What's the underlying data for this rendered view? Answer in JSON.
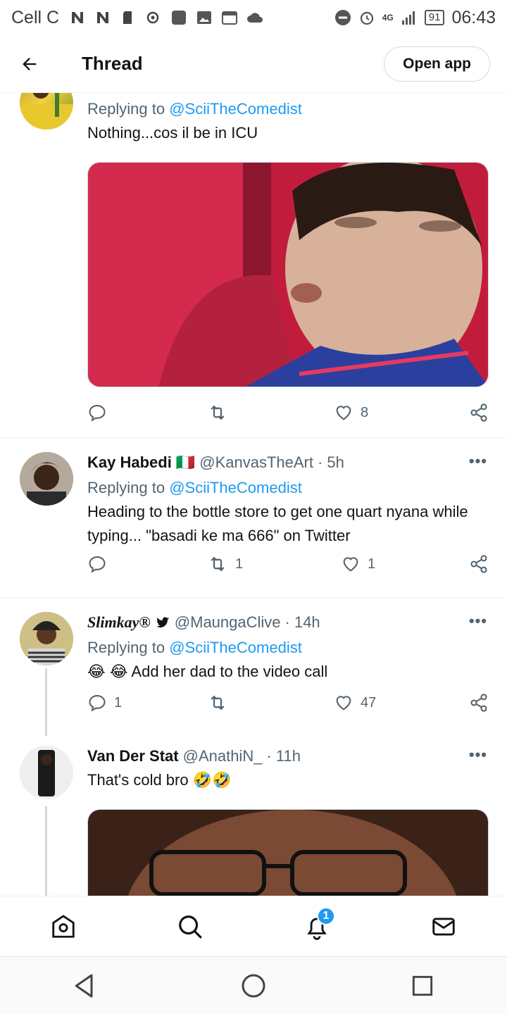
{
  "status_bar": {
    "carrier": "Cell C",
    "network": "4G",
    "battery": "91",
    "time": "06:43"
  },
  "header": {
    "title": "Thread",
    "open_app_label": "Open app"
  },
  "tweets": [
    {
      "replying_label": "Replying to",
      "replying_to": "@SciiTheComedist",
      "text": "Nothing...cos il be in ICU",
      "actions": {
        "replies": "",
        "retweets": "",
        "likes": "8"
      }
    },
    {
      "name": "Kay Habedi",
      "flag": "🇮🇹",
      "handle": "@KanvasTheArt",
      "time": "· 5h",
      "replying_label": "Replying to",
      "replying_to": "@SciiTheComedist",
      "text": "Heading to the bottle store to get one quart nyana while typing... \"basadi ke ma 666\" on Twitter",
      "actions": {
        "replies": "",
        "retweets": "1",
        "likes": "1"
      }
    },
    {
      "name": "Slimkay®",
      "handle": "@MaungaClive",
      "time": "· 14h",
      "replying_label": "Replying to",
      "replying_to": "@SciiTheComedist",
      "text": "😂 😂 Add her dad to the video call",
      "actions": {
        "replies": "1",
        "retweets": "",
        "likes": "47"
      }
    },
    {
      "name": "Van Der Stat",
      "handle": "@AnathiN_",
      "time": "· 11h",
      "text": "That's cold bro 🤣🤣"
    }
  ],
  "bottom_nav": {
    "notifications_badge": "1"
  },
  "colors": {
    "accent": "#1d9bf0",
    "secondary_text": "#536471",
    "border": "#cfd9de"
  }
}
